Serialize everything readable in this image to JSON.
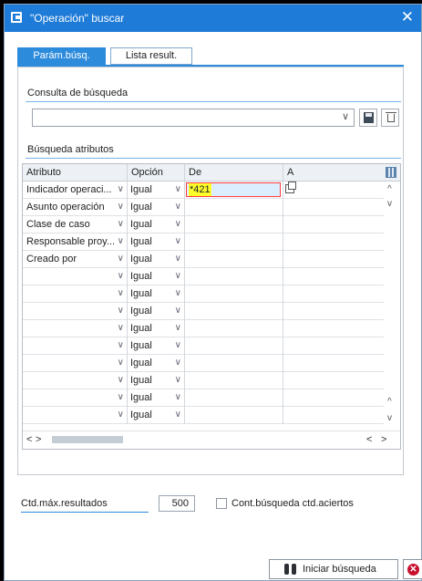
{
  "window": {
    "title": "\"Operación\" buscar",
    "close_glyph": "✕"
  },
  "tabs": [
    {
      "label": "Parám.búsq.",
      "active": true
    },
    {
      "label": "Lista result.",
      "active": false
    }
  ],
  "query": {
    "title": "Consulta de búsqueda",
    "value": "",
    "icons": [
      "save-icon",
      "delete-icon"
    ]
  },
  "attributes": {
    "title": "Búsqueda atributos",
    "columns": [
      "Atributo",
      "Opción",
      "De",
      "A"
    ],
    "rows": [
      {
        "attribute": "Indicador operaci...",
        "option": "Igual",
        "from": "*421",
        "to": ""
      },
      {
        "attribute": "Asunto operación",
        "option": "Igual",
        "from": "",
        "to": ""
      },
      {
        "attribute": "Clase de caso",
        "option": "Igual",
        "from": "",
        "to": ""
      },
      {
        "attribute": "Responsable proy...",
        "option": "Igual",
        "from": "",
        "to": ""
      },
      {
        "attribute": "Creado por",
        "option": "Igual",
        "from": "",
        "to": ""
      },
      {
        "attribute": "",
        "option": "Igual",
        "from": "",
        "to": ""
      },
      {
        "attribute": "",
        "option": "Igual",
        "from": "",
        "to": ""
      },
      {
        "attribute": "",
        "option": "Igual",
        "from": "",
        "to": ""
      },
      {
        "attribute": "",
        "option": "Igual",
        "from": "",
        "to": ""
      },
      {
        "attribute": "",
        "option": "Igual",
        "from": "",
        "to": ""
      },
      {
        "attribute": "",
        "option": "Igual",
        "from": "",
        "to": ""
      },
      {
        "attribute": "",
        "option": "Igual",
        "from": "",
        "to": ""
      },
      {
        "attribute": "",
        "option": "Igual",
        "from": "",
        "to": ""
      },
      {
        "attribute": "",
        "option": "Igual",
        "from": "",
        "to": ""
      }
    ]
  },
  "footer": {
    "max_results_label": "Ctd.máx.resultados",
    "max_results_value": "500",
    "continue_search_label": "Cont.búsqueda ctd.aciertos",
    "continue_search_checked": false
  },
  "buttons": {
    "start_search": "Iniciar búsqueda"
  },
  "colors": {
    "titlebar": "#1e7bd8",
    "active_tab": "#2d8bdc",
    "highlight": "#ffff2a",
    "input_focus_border": "#ff3b3b",
    "cancel": "#c8102e"
  }
}
